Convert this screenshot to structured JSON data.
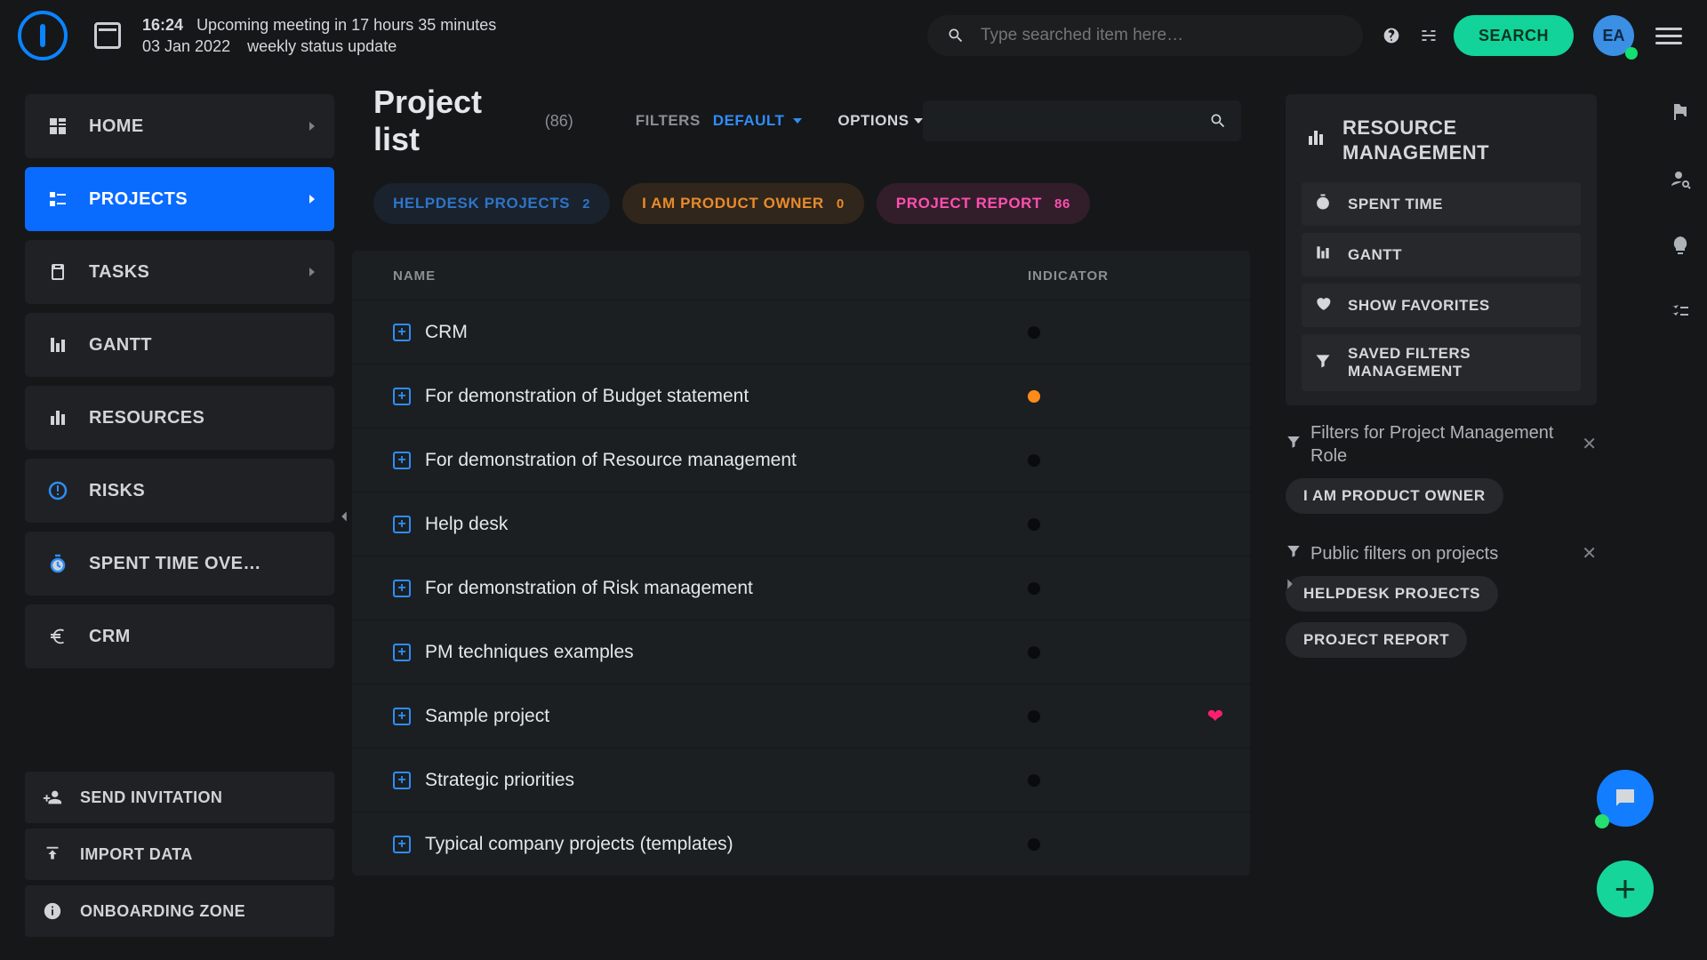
{
  "colors": {
    "accent_blue": "#0a6bff",
    "accent_green": "#12d39a",
    "accent_pink": "#ff4fb0",
    "accent_orange": "#e88b2d"
  },
  "header": {
    "time": "16:24",
    "meeting_countdown": "Upcoming meeting in 17 hours 35 minutes",
    "date": "03 Jan 2022",
    "meeting_title": "weekly status update",
    "search_placeholder": "Type searched item here…",
    "search_button": "SEARCH",
    "avatar_initials": "EA"
  },
  "sidebar": {
    "items": [
      {
        "label": "HOME",
        "icon": "home-icon",
        "has_caret": true,
        "active": false
      },
      {
        "label": "PROJECTS",
        "icon": "projects-icon",
        "has_caret": true,
        "active": true
      },
      {
        "label": "TASKS",
        "icon": "tasks-icon",
        "has_caret": true,
        "active": false
      },
      {
        "label": "GANTT",
        "icon": "gantt-icon",
        "has_caret": false,
        "active": false
      },
      {
        "label": "RESOURCES",
        "icon": "resources-icon",
        "has_caret": false,
        "active": false
      },
      {
        "label": "RISKS",
        "icon": "risks-icon",
        "has_caret": false,
        "active": false
      },
      {
        "label": "SPENT TIME OVE…",
        "icon": "clock-icon",
        "has_caret": false,
        "active": false
      },
      {
        "label": "CRM",
        "icon": "euro-icon",
        "has_caret": false,
        "active": false
      }
    ],
    "bottom": [
      {
        "label": "SEND INVITATION",
        "icon": "invite-icon"
      },
      {
        "label": "IMPORT DATA",
        "icon": "import-icon"
      },
      {
        "label": "ONBOARDING ZONE",
        "icon": "info-icon"
      }
    ]
  },
  "main": {
    "title": "Project list",
    "count_label": "(86)",
    "filters_label": "FILTERS",
    "filters_current": "DEFAULT",
    "options_label": "OPTIONS",
    "chips": [
      {
        "label": "HELPDESK PROJECTS",
        "count": "2",
        "variant": "blue"
      },
      {
        "label": "I AM PRODUCT OWNER",
        "count": "0",
        "variant": "orange"
      },
      {
        "label": "PROJECT REPORT",
        "count": "86",
        "variant": "pink"
      }
    ],
    "columns": {
      "name": "NAME",
      "indicator": "INDICATOR"
    },
    "rows": [
      {
        "name": "CRM",
        "indicator": "black",
        "favorite": false
      },
      {
        "name": "For demonstration of Budget statement",
        "indicator": "orange",
        "favorite": false
      },
      {
        "name": "For demonstration of Resource management",
        "indicator": "black",
        "favorite": false
      },
      {
        "name": "Help desk",
        "indicator": "black",
        "favorite": false
      },
      {
        "name": "For demonstration of Risk management",
        "indicator": "black",
        "favorite": false
      },
      {
        "name": "PM techniques examples",
        "indicator": "black",
        "favorite": false
      },
      {
        "name": "Sample project",
        "indicator": "black",
        "favorite": true
      },
      {
        "name": "Strategic priorities",
        "indicator": "black",
        "favorite": false
      },
      {
        "name": "Typical company projects (templates)",
        "indicator": "black",
        "favorite": false
      }
    ]
  },
  "right": {
    "heading": "RESOURCE MANAGEMENT",
    "items": [
      {
        "label": "SPENT TIME",
        "icon": "clock-icon"
      },
      {
        "label": "GANTT",
        "icon": "gantt-icon"
      },
      {
        "label": "SHOW FAVORITES",
        "icon": "heart-icon"
      },
      {
        "label": "SAVED FILTERS MANAGEMENT",
        "icon": "funnel-icon"
      }
    ],
    "section1": {
      "title": "Filters for Project Management Role",
      "pills": [
        "I AM PRODUCT OWNER"
      ]
    },
    "section2": {
      "title": "Public filters on projects",
      "pills": [
        "HELPDESK PROJECTS",
        "PROJECT REPORT"
      ]
    }
  }
}
